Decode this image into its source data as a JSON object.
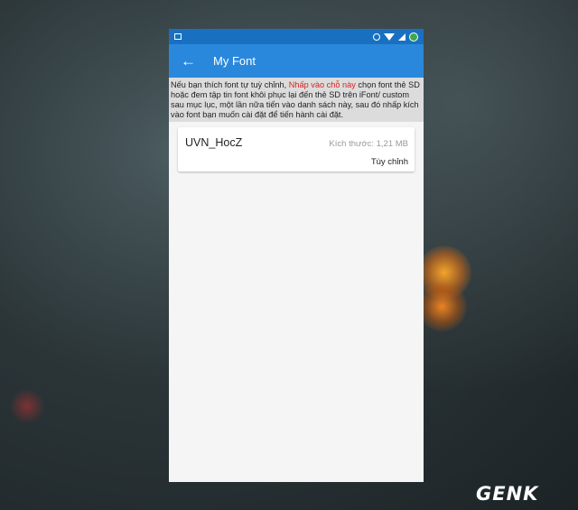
{
  "app_title": "My Font",
  "notice": {
    "part1": "Nếu bạn thích font tự tuỳ chỉnh, ",
    "link": "Nhấp vào chỗ này",
    "part2": " chọn font thẻ SD hoặc đem tập tin font khôi phục lại đến thẻ SD trên iFont/ custom sau mục lục, một lần nữa tiến vào danh sách này, sau đó nhấp kích vào font bạn muốn cài đặt để tiến hành cài đặt."
  },
  "fonts": [
    {
      "name": "UVN_HocZ",
      "size": "Kích thước: 1,21 MB",
      "action": "Tùy chỉnh"
    }
  ],
  "watermark": "GENK",
  "colors": {
    "statusbar": "#1a70c0",
    "appbar": "#2a88dc",
    "notice_link": "#e0201e"
  },
  "icons": [
    "back-arrow-icon",
    "image-icon",
    "alarm-icon",
    "wifi-icon",
    "signal-icon",
    "battery-icon"
  ]
}
